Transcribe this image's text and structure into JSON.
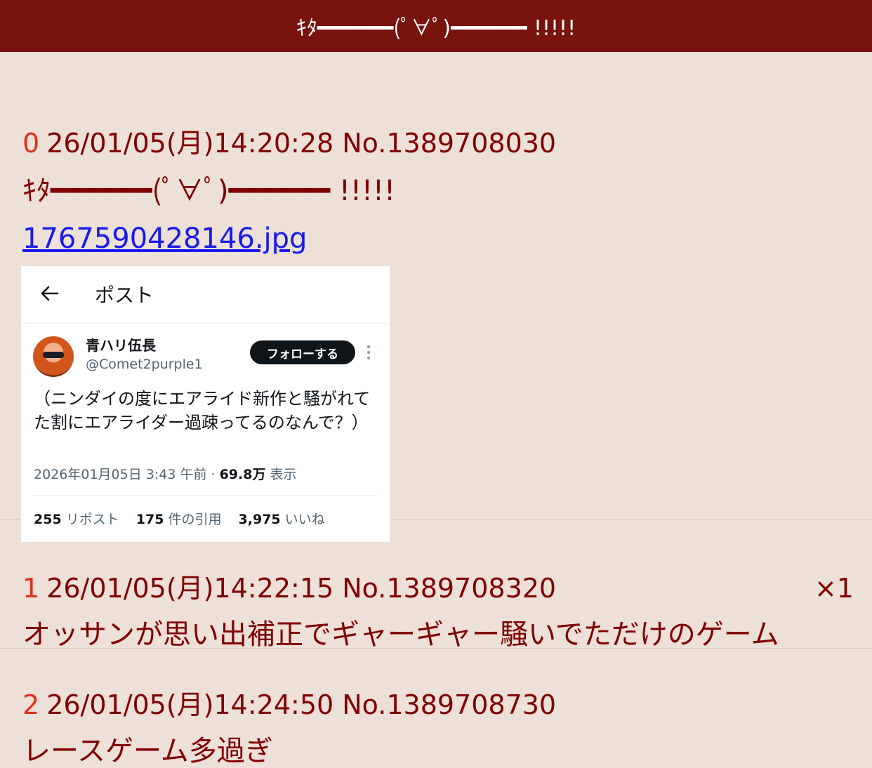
{
  "header": {
    "title": "ｷﾀ━━━━━━(ﾟ∀ﾟ)━━━━━━ !!!!!"
  },
  "posts": [
    {
      "num": "0",
      "meta": "26/01/05(月)14:20:28 No.1389708030",
      "text": "ｷﾀ━━━━━━(ﾟ∀ﾟ)━━━━━━ !!!!!",
      "file": "1767590428146.jpg"
    },
    {
      "num": "1",
      "meta": "26/01/05(月)14:22:15 No.1389708320",
      "count": "×1",
      "text": "オッサンが思い出補正でギャーギャー騒いでただけのゲーム"
    },
    {
      "num": "2",
      "meta": "26/01/05(月)14:24:50 No.1389708730",
      "text": "レースゲーム多過ぎ"
    }
  ],
  "tweet": {
    "header_title": "ポスト",
    "name": "青ハリ伍長",
    "handle": "@Comet2purple1",
    "follow_label": "フォローする",
    "text": "（ニンダイの度にエアライド新作と騒がれてた割にエアライダー過疎ってるのなんで？）",
    "date": "2026年01月05日 3:43 午前 · ",
    "views_count": "69.8万",
    "views_label": " 表示",
    "reposts_count": "255",
    "reposts_label": " リポスト",
    "quotes_count": "175",
    "quotes_label": " 件の引用",
    "likes_count": "3,975",
    "likes_label": " いいね"
  },
  "colors": {
    "header_bg": "#78130e",
    "page_bg": "#ede0d6",
    "text": "#800000",
    "post_number": "#e0301e",
    "link": "#1a1aee"
  },
  "icons": [
    "back-arrow-icon",
    "more-vertical-icon",
    "avatar"
  ]
}
